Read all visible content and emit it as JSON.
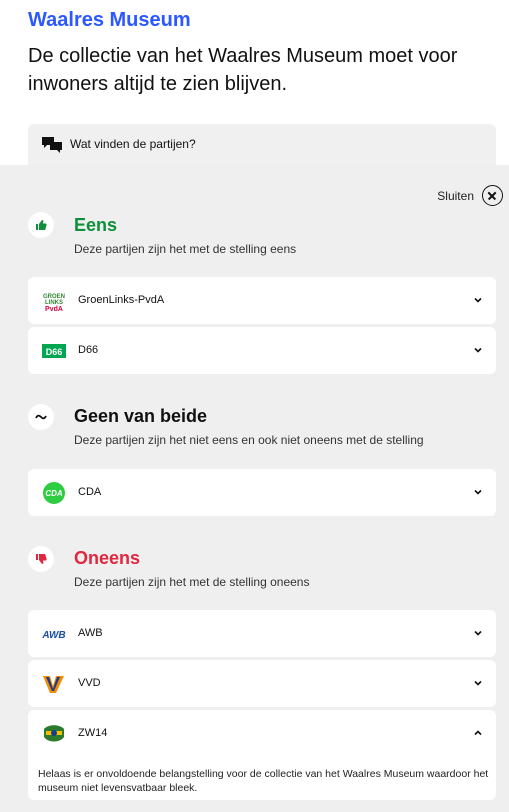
{
  "header": {
    "topic": "Waalres Museum",
    "statement": "De collectie van het Waalres Museum moet voor inwoners altijd te zien blijven."
  },
  "tab": {
    "label": "Wat vinden de partijen?",
    "icon": "speech-bubbles-icon"
  },
  "panel": {
    "close_label": "Sluiten"
  },
  "sections": [
    {
      "title": "Eens",
      "subtitle": "Deze partijen zijn het met de stelling eens",
      "color": "#0e8f3a",
      "icon": "thumbs-up-icon",
      "parties": [
        {
          "name": "GroenLinks-PvdA",
          "logo_text": "GL PvdA",
          "logo_color": "#d4003b"
        },
        {
          "name": "D66",
          "logo_text": "D66",
          "logo_color": "#00a651"
        }
      ]
    },
    {
      "title": "Geen van beide",
      "subtitle": "Deze partijen zijn het niet eens en ook niet oneens met de stelling",
      "color": "#111111",
      "icon": "tilde-icon",
      "parties": [
        {
          "name": "CDA",
          "logo_text": "CDA",
          "logo_color": "#2ecc40"
        }
      ]
    },
    {
      "title": "Oneens",
      "subtitle": "Deze partijen zijn het met de stelling oneens",
      "color": "#e0273e",
      "icon": "thumbs-down-icon",
      "parties": [
        {
          "name": "AWB",
          "logo_text": "AWB",
          "logo_color": "#1a4fa0"
        },
        {
          "name": "VVD",
          "logo_text": "VVD",
          "logo_color": "#f28c00"
        },
        {
          "name": "ZW14",
          "logo_text": "ZW14",
          "logo_color": "#2c7a2c",
          "expanded": true,
          "explanation": "Helaas is er onvoldoende belangstelling voor de collectie van het Waalres Museum waardoor het museum niet levensvatbaar bleek."
        }
      ]
    }
  ]
}
